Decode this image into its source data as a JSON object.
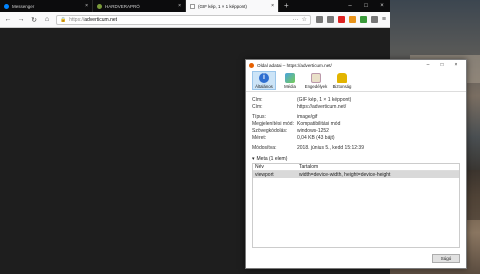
{
  "browser": {
    "tabs": [
      {
        "title": "Messenger",
        "color": "#0084ff",
        "active": false
      },
      {
        "title": "HARDVERAPRÓ",
        "color": "#7a9a3a",
        "active": false
      },
      {
        "title": "(GIF kép, 1 × 1 képpont)",
        "color": "#ffffff",
        "active": true
      }
    ],
    "url_proto": "https://",
    "url_host": "adverticum.net"
  },
  "dialog": {
    "title": "Oldal adatai – https://adverticum.net/",
    "tabs": [
      "Általános",
      "Média",
      "Engedélyek",
      "Biztonság"
    ],
    "rows1": [
      {
        "k": "Cím:",
        "v": "(GIF kép, 1 × 1 képpont)"
      },
      {
        "k": "Cím:",
        "v": "https://adverticum.net/"
      }
    ],
    "rows2": [
      {
        "k": "Típus:",
        "v": "image/gif"
      },
      {
        "k": "Megjelenítési mód:",
        "v": "Kompatibilitási mód"
      },
      {
        "k": "Szövegkódolás:",
        "v": "windows-1252"
      },
      {
        "k": "Méret:",
        "v": "0,04 KB (43 bájt)"
      }
    ],
    "rows3": [
      {
        "k": "Módosítva:",
        "v": "2018. június 5., kedd 15:12:39"
      }
    ],
    "meta_label": "Meta (1 elem)",
    "meta_headers": [
      "Név",
      "Tartalom"
    ],
    "meta_rows": [
      {
        "name": "viewport",
        "content": "width=device-width, height=device-height"
      }
    ],
    "help_label": "Súgó"
  }
}
